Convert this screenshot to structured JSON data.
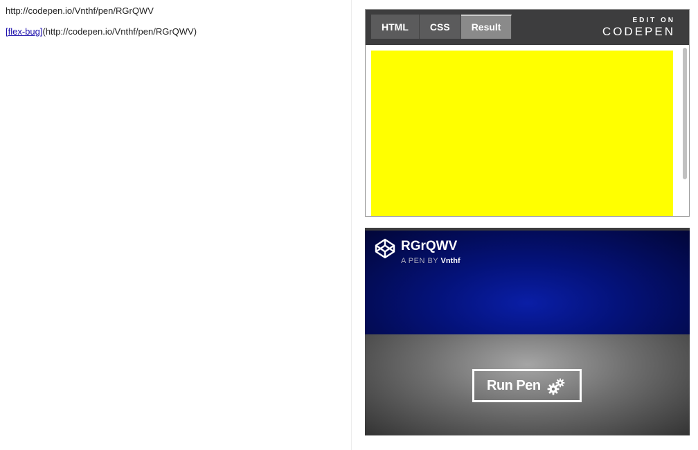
{
  "left": {
    "url_text": "http://codepen.io/Vnthf/pen/RGrQWV",
    "link_label": "[flex-bug]",
    "link_suffix": "(http://codepen.io/Vnthf/pen/RGrQWV)"
  },
  "embed": {
    "tabs": [
      {
        "label": "HTML",
        "active": false
      },
      {
        "label": "CSS",
        "active": false
      },
      {
        "label": "Result",
        "active": true
      }
    ],
    "edit_on": "EDIT ON",
    "codepen_wordmark": "CODEPEN",
    "result_box_color": "#ffff00"
  },
  "preview": {
    "title": "RGrQWV",
    "by_prefix": "A PEN BY",
    "author": "Vnthf",
    "run_label": "Run Pen",
    "icons": [
      "codepen-logo-icon",
      "gears-icon"
    ]
  }
}
